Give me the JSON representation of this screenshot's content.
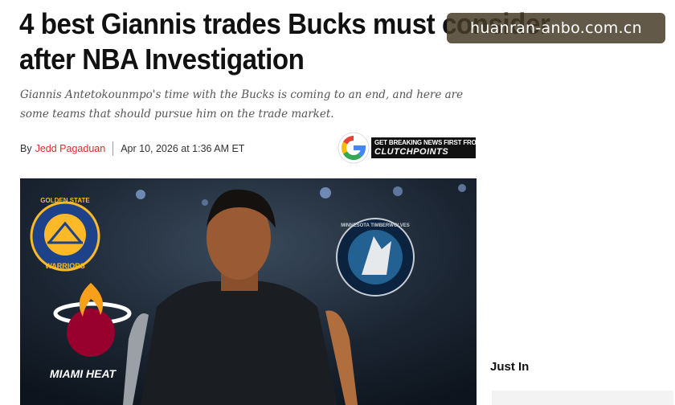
{
  "article": {
    "headline": "4 best Giannis trades Bucks must consider after NBA Investigation",
    "subtitle": "Giannis Antetokounmpo's time with the Bucks is coming to an end, and here are some teams that should pursue him on the trade market.",
    "byline_prefix": "By",
    "author": "Jedd Pagaduan",
    "date": "Apr 10, 2026 at 1:36 AM ET"
  },
  "watermark": {
    "text": "huanran-anbo.com.cn"
  },
  "promo": {
    "line1": "GET BREAKING NEWS FIRST FROM",
    "line2": "CLUTCHPOINTS",
    "icon": "google-g-icon"
  },
  "hero": {
    "logos": {
      "warriors_top": "GOLDEN STATE",
      "warriors_bottom": "WARRIORS",
      "heat": "MIAMI HEAT",
      "wolves_ring": "MINNESOTA TIMBERWOLVES"
    }
  },
  "sidebar": {
    "heading": "Just In"
  },
  "colors": {
    "author": "#d0312d",
    "warriors_blue": "#1d428a",
    "warriors_gold": "#fdb927",
    "heat_red": "#98002e",
    "wolves_navy": "#0c2340"
  }
}
